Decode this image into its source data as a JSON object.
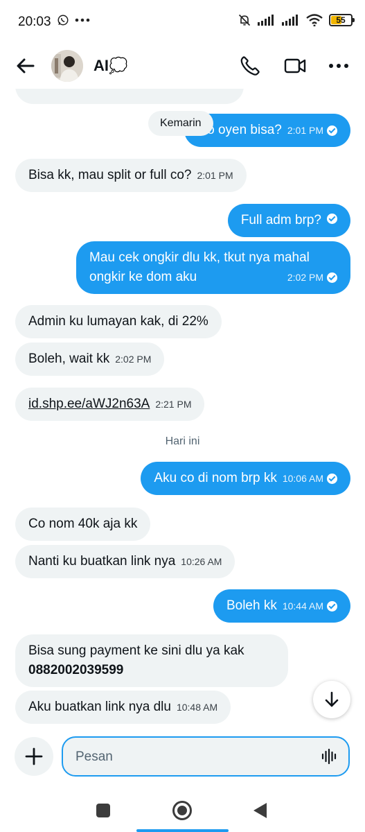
{
  "status_bar": {
    "time": "20:03",
    "left_icons": [
      "whatsapp-icon",
      "more-dots-icon"
    ],
    "right_icons": [
      "bell-off-icon",
      "signal-icon",
      "signal-icon",
      "wifi-icon"
    ],
    "battery_level": "55",
    "battery_fraction": 0.55
  },
  "header": {
    "contact_name": "AI💭",
    "actions": [
      "phone-icon",
      "video-icon",
      "more-icon"
    ]
  },
  "chat": {
    "date_pill": "Kemarin",
    "date_separator_today": "Hari ini",
    "messages": [
      {
        "dir": "out",
        "text": "Co oyen bisa?",
        "time": "2:01 PM"
      },
      {
        "dir": "in",
        "text": "Bisa kk, mau split or full co?",
        "time": "2:01 PM"
      },
      {
        "dir": "out",
        "text": "Full adm brp?",
        "time": ""
      },
      {
        "dir": "out",
        "text_line1": "Mau cek ongkir dlu kk, tkut nya mahal",
        "text_line2": "ongkir ke dom aku",
        "time": "2:02 PM"
      },
      {
        "dir": "in",
        "text": "Admin ku lumayan kak, di 22%",
        "time": ""
      },
      {
        "dir": "in",
        "text": "Boleh, wait kk",
        "time": "2:02 PM"
      },
      {
        "dir": "in",
        "link": "id.shp.ee/aWJ2n63A",
        "time": "2:21 PM"
      },
      {
        "dir": "out",
        "text": "Aku co di nom brp kk",
        "time": "10:06 AM"
      },
      {
        "dir": "in",
        "text": "Co nom 40k aja kk",
        "time": ""
      },
      {
        "dir": "in",
        "text": "Nanti ku buatkan link nya",
        "time": "10:26 AM"
      },
      {
        "dir": "out",
        "text": "Boleh kk",
        "time": "10:44 AM"
      },
      {
        "dir": "in",
        "text_line1": "Bisa sung payment ke sini dlu ya kak",
        "text_line2": "0882002039599",
        "time": ""
      },
      {
        "dir": "in",
        "text": "Aku buatkan link nya dlu",
        "time": "10:48 AM"
      }
    ]
  },
  "composer": {
    "placeholder": "Pesan",
    "value": ""
  },
  "colors": {
    "outgoing": "#1d9bf0",
    "incoming": "#eff3f4",
    "text": "#0f1419"
  }
}
